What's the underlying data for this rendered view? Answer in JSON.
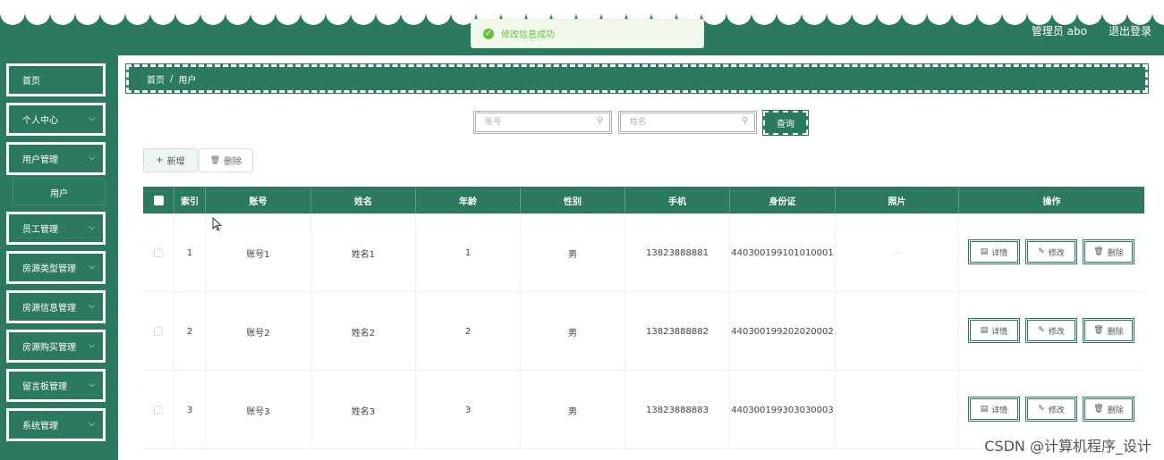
{
  "header": {
    "user_label": "管理员 abo",
    "logout_label": "退出登录"
  },
  "toast": {
    "message": "修改信息成功"
  },
  "sidebar": {
    "items": [
      {
        "label": "首页",
        "expandable": false
      },
      {
        "label": "个人中心",
        "expandable": true
      },
      {
        "label": "用户管理",
        "expandable": true
      },
      {
        "label": "员工管理",
        "expandable": true
      },
      {
        "label": "房源类型管理",
        "expandable": true
      },
      {
        "label": "房源信息管理",
        "expandable": true
      },
      {
        "label": "房源购买管理",
        "expandable": true
      },
      {
        "label": "留言板管理",
        "expandable": true
      },
      {
        "label": "系统管理",
        "expandable": true
      }
    ],
    "submenu": {
      "label": "用户"
    }
  },
  "breadcrumb": {
    "home": "首页",
    "separator": "/",
    "current": "用户"
  },
  "search": {
    "account_placeholder": "账号",
    "name_placeholder": "姓名",
    "query_label": "查询"
  },
  "toolbar": {
    "add_label": "新增",
    "delete_label": "删除"
  },
  "table": {
    "columns": [
      "索引",
      "账号",
      "姓名",
      "年龄",
      "性别",
      "手机",
      "身份证",
      "照片",
      "操作"
    ],
    "rows": [
      {
        "index": "1",
        "account": "账号1",
        "name": "姓名1",
        "age": "1",
        "gender": "男",
        "phone": "13823888881",
        "id_card": "440300199101010001"
      },
      {
        "index": "2",
        "account": "账号2",
        "name": "姓名2",
        "age": "2",
        "gender": "男",
        "phone": "13823888882",
        "id_card": "440300199202020002"
      },
      {
        "index": "3",
        "account": "账号3",
        "name": "姓名3",
        "age": "3",
        "gender": "男",
        "phone": "13823888883",
        "id_card": "440300199303030003"
      }
    ],
    "actions": {
      "detail": "详情",
      "edit": "修改",
      "delete": "删除"
    }
  },
  "watermark": "CSDN @计算机程序_设计",
  "colors": {
    "primary": "#2b7a5d",
    "success": "#67c23a"
  }
}
